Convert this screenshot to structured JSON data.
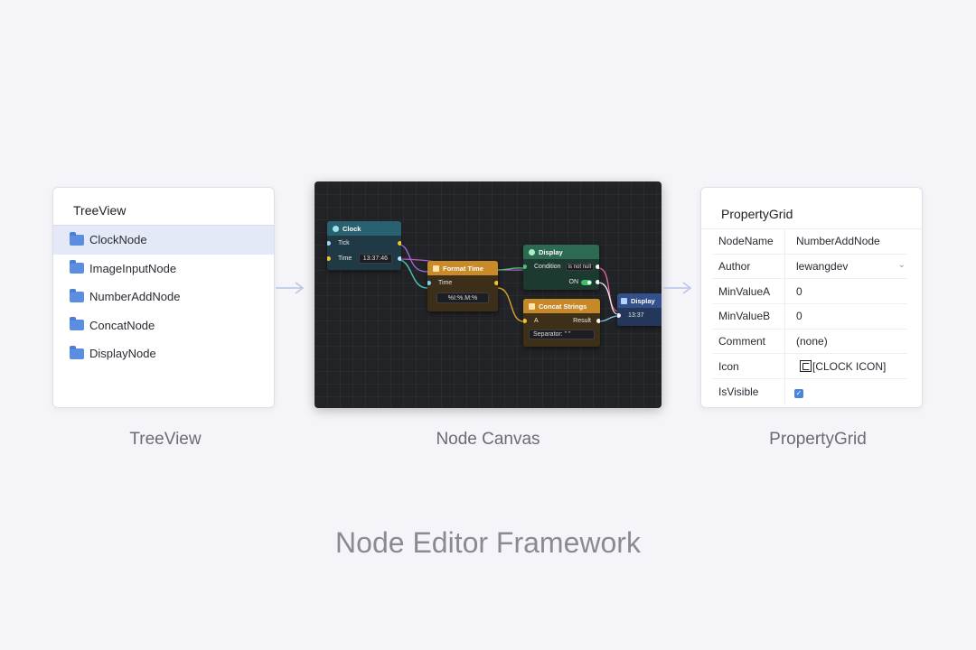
{
  "tree": {
    "title": "TreeView",
    "items": [
      {
        "label": "ClockNode",
        "icon": "folder-icon",
        "selected": true
      },
      {
        "label": "ImageInputNode",
        "icon": "folder-icon"
      },
      {
        "label": "NumberAddNode",
        "icon": "folder-icon"
      },
      {
        "label": "ConcatNode",
        "icon": "folder-icon"
      },
      {
        "label": "DisplayNode",
        "icon": "folder-icon"
      }
    ]
  },
  "canvas": {
    "nodes": {
      "clock": {
        "title": "Clock",
        "port_tick": "Tick",
        "port_time": "Time",
        "time_value": "13:37:46"
      },
      "format": {
        "title": "Format Time",
        "port_time": "Time",
        "format_value": "%Ⅰ:%.M:%"
      },
      "display1": {
        "title": "Display",
        "port_condition": "Condition",
        "condition_value": "is not null",
        "toggle_label": "ON"
      },
      "concat": {
        "title": "Concat Strings",
        "port_a": "A",
        "port_result": "Result",
        "separator": "Separator: \" \""
      },
      "display2": {
        "title": "Display",
        "value": "13:37"
      }
    },
    "colors": {
      "clock": "#2a6170",
      "format": "#c98a2a",
      "display": "#2d6a52",
      "concat": "#c68828",
      "display2": "#34508a"
    }
  },
  "properties": {
    "title": "PropertyGrid",
    "rows": [
      {
        "key": "NodeName",
        "value": "NumberAddNode"
      },
      {
        "key": "Author",
        "value": "lewangdev"
      },
      {
        "key": "MinValueA",
        "value": "0"
      },
      {
        "key": "MinValueB",
        "value": "0"
      },
      {
        "key": "Comment",
        "value": "(none)"
      },
      {
        "key": "Icon",
        "value": "[CLOCK ICON]"
      },
      {
        "key": "IsVisible",
        "value": ""
      }
    ]
  },
  "captions": {
    "tree": "TreeView",
    "canvas": "Node Canvas",
    "properties": "PropertyGrid"
  },
  "title": "Node Editor Framework"
}
